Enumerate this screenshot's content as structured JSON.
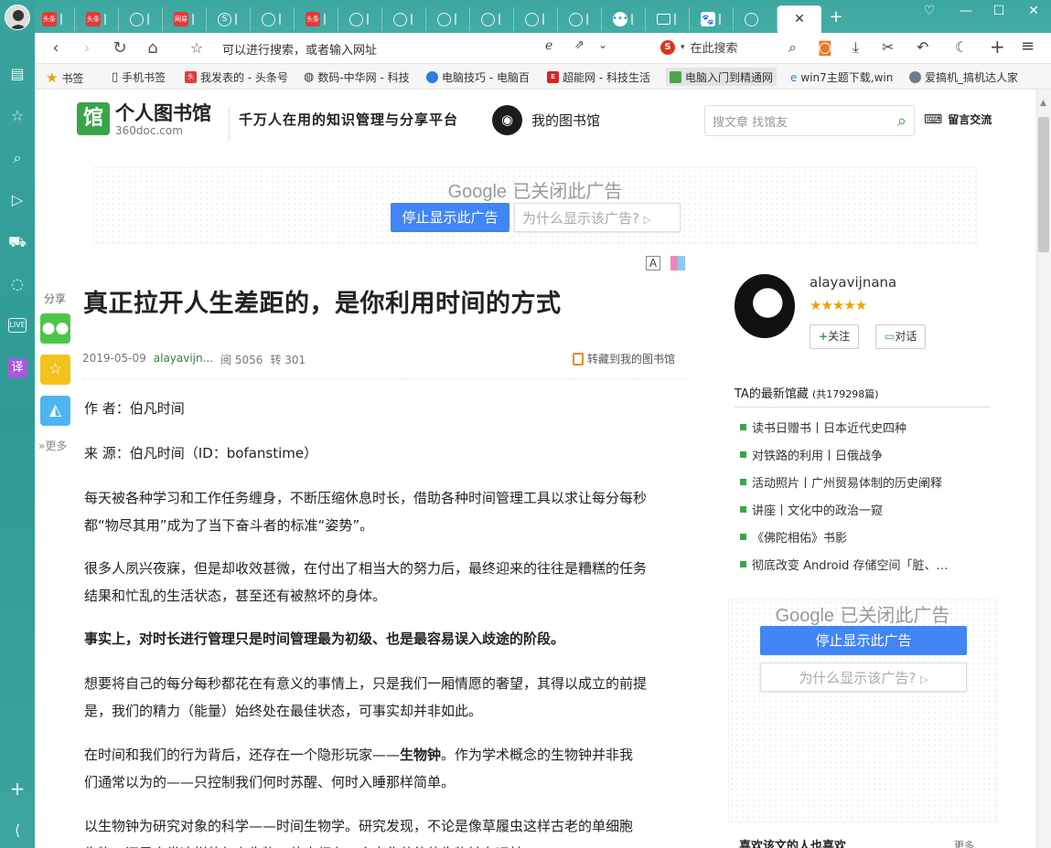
{
  "browser": {
    "tabs": [
      {
        "icon": "avatar"
      },
      {
        "icon": "toutiao-icon",
        "text": "头条"
      },
      {
        "icon": "toutiao-icon",
        "text": "头条"
      },
      {
        "icon": "globe-icon"
      },
      {
        "icon": "netease-icon",
        "text": "网易"
      },
      {
        "icon": "sogou-icon",
        "text": "S"
      },
      {
        "icon": "shield-icon"
      },
      {
        "icon": "toutiao-icon",
        "text": "头条"
      },
      {
        "icon": "globe-icon"
      },
      {
        "icon": "globe-icon"
      },
      {
        "icon": "globe-icon"
      },
      {
        "icon": "globe-icon"
      },
      {
        "icon": "globe-icon"
      },
      {
        "icon": "chat-icon"
      },
      {
        "icon": "table-icon"
      },
      {
        "icon": "baidu-icon"
      },
      {
        "icon": "globe-icon"
      }
    ],
    "address_placeholder": "可以进行搜索，或者输入网址",
    "search_placeholder": "在此搜索",
    "bookmarks": [
      {
        "label": "书签"
      },
      {
        "label": "手机书签"
      },
      {
        "label": "我发表的 - 头条号"
      },
      {
        "label": "数码-中华网 - 科技"
      },
      {
        "label": "电脑技巧 - 电脑百"
      },
      {
        "label": "超能网 - 科技生活"
      },
      {
        "label": "电脑入门到精通网"
      },
      {
        "label": "win7主题下载,win"
      },
      {
        "label": "爱搞机_搞机达人家"
      }
    ]
  },
  "site": {
    "logo_cn": "个人图书馆",
    "logo_en": "360doc.com",
    "logo_mark": "馆",
    "slogan": "千万人在用的知识管理与分享平台",
    "my_library": "我的图书馆",
    "search_placeholder": "搜文章 找馆友",
    "message": "留言交流"
  },
  "ads": {
    "google": "Google",
    "closed": "已关闭此广告",
    "stop": "停止显示此广告",
    "why": "为什么显示该广告?",
    "why_arrow": "▷"
  },
  "share": {
    "label": "分享",
    "more": "更多"
  },
  "article": {
    "font_a": "A",
    "title": "真正拉开人生差距的，是你利用时间的方式",
    "date": "2019-05-09",
    "author": "alayavijn...",
    "reads": "阅 5056",
    "reposts": "转 301",
    "save": "转藏到我的图书馆",
    "p1": "作 者：伯凡时间",
    "p2": "来 源：伯凡时间（ID：bofanstime）",
    "p3a": "每天被各种学习和工作任务缠身，不断压缩休息时长，借助各种时间管理工具以求让每分每秒",
    "p3b": "都“物尽其用”成为了当下奋斗者的标准“姿势”。",
    "p4a": "很多人夙兴夜寐，但是却收效甚微，在付出了相当大的努力后，最终迎来的往往是糟糕的任务",
    "p4b": "结果和忙乱的生活状态，甚至还有被熬坏的身体。",
    "p5": "事实上，对时长进行管理只是时间管理最为初级、也是最容易误入歧途的阶段。",
    "p6a": "想要将自己的每分每秒都花在有意义的事情上，只是我们一厢情愿的奢望，其得以成立的前提",
    "p6b": "是，我们的精力（能量）始终处在最佳状态，可事实却并非如此。",
    "p7a1": "在时间和我们的行为背后，还存在一个隐形玩家——",
    "p7a2": "生物钟",
    "p7a3": "。作为学术概念的生物钟并非我",
    "p7b": "们通常以为的——只控制我们何时苏醒、何时入睡那样简单。",
    "p8a": "以生物钟为研究对象的科学——时间生物学。研究发现，不论是像草履虫这样古老的单细胞",
    "p8b": "生物，还是人类这样的复杂生物，体内都有一个变化节律的生物钟在运转"
  },
  "sidebar": {
    "username": "alayavijnana",
    "stars": "★★★★★",
    "follow": "关注",
    "follow_plus": "+",
    "chat": "对话",
    "latest_title": "TA的最新馆藏",
    "latest_count": "(共179298篇)",
    "latest": [
      "读书日赠书丨日本近代史四种",
      "对铁路的利用丨日俄战争",
      "活动照片丨广州贸易体制的历史阐释",
      "讲座丨文化中的政治一窥",
      "《佛陀相佑》书影",
      "彻底改变 Android 存储空间「脏、…"
    ],
    "like_title": "喜欢该文的人也喜欢",
    "more": "更多"
  }
}
